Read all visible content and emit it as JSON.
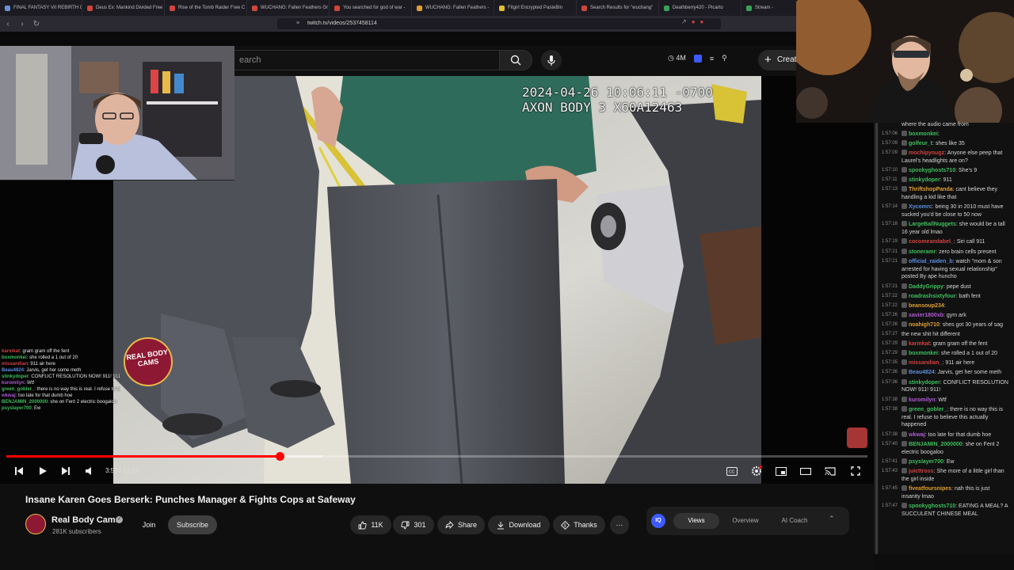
{
  "browser": {
    "tabs": [
      {
        "label": "FINAL FANTASY VII REBIRTH C",
        "color": "#6b8fd6"
      },
      {
        "label": "Deus Ex: Mankind Divided Free",
        "color": "#d0453a"
      },
      {
        "label": "Rise of the Tomb Raider Free C",
        "color": "#d0453a"
      },
      {
        "label": "WUCHANG: Fallen Feathers Gr",
        "color": "#d0453a"
      },
      {
        "label": "You searched for god of war -",
        "color": "#d0453a"
      },
      {
        "label": "WUCHANG: Fallen Feathers - ",
        "color": "#e0a030"
      },
      {
        "label": "Fitgirl Encrypted PasteBin",
        "color": "#e0c030"
      },
      {
        "label": "Search Results for \"wuchang\"",
        "color": "#d0453a"
      },
      {
        "label": "Deathberry420 - Picarto",
        "color": "#3aa05a"
      },
      {
        "label": "Stream -",
        "color": "#3aa05a"
      }
    ],
    "url": "twitch.tv/videos/2537458114"
  },
  "youtube": {
    "search_placeholder": "earch",
    "ext_count": "4M",
    "create_label": "Create",
    "colors": {
      "accent": "#ff0000",
      "bg": "#0f0f0f"
    }
  },
  "video": {
    "overlay_timestamp": "2024-04-26 10:06:11 -0700\nAXON BODY 3 X60A12463",
    "logo_text": "REAL BODY CAMS",
    "time_display": "3:53 / 12:16",
    "progress_fraction": 0.317,
    "buffer_fraction": 0.05,
    "controls": [
      "previous-icon",
      "play-icon",
      "next-icon",
      "volume-icon",
      "captions-icon",
      "settings-icon",
      "miniplayer-icon",
      "theater-icon",
      "cast-icon",
      "fullscreen-icon"
    ]
  },
  "overlay_chat": [
    {
      "user": "karmkat",
      "msg": "gram gram off the fent",
      "color": "#d14242"
    },
    {
      "user": "boxmonkei",
      "msg": "she rolled a 1 out of 20",
      "color": "#3fbf5f"
    },
    {
      "user": "missandian",
      "msg": "911 air here",
      "color": "#d14242"
    },
    {
      "user": "Beau4824",
      "msg": "Jarvis, get her some meth",
      "color": "#5b8fe0"
    },
    {
      "user": "stinkydoper",
      "msg": "CONFLICT RESOLUTION NOW! 911! 911!",
      "color": "#3fbf5f"
    },
    {
      "user": "kuromilyn",
      "msg": "Wtf",
      "color": "#b05ad6"
    },
    {
      "user": "green_gobler_",
      "msg": "there is no way this is real. I refuse to believe this actually happened",
      "color": "#3fbf5f"
    },
    {
      "user": "wkwaj",
      "msg": "too late for that dumb hoe",
      "color": "#b05ad6"
    },
    {
      "user": "BENJAMIN_2000000",
      "msg": "she on Fent 2 electric boogaloo",
      "color": "#3fbf5f"
    },
    {
      "user": "psyslayer700",
      "msg": "Ew",
      "color": "#3fbf5f"
    }
  ],
  "info": {
    "title": "Insane Karen Goes Berserk: Punches Manager & Fights Cops at Safeway",
    "channel": "Real Body Cams",
    "subscribers": "281K subscribers",
    "join": "Join",
    "subscribe": "Subscribe",
    "likes": "11K",
    "dislikes": "301",
    "share": "Share",
    "download": "Download",
    "thanks": "Thanks"
  },
  "iq": {
    "logo": "IQ",
    "tabs": [
      "Views",
      "Overview",
      "AI Coach"
    ]
  },
  "chat": [
    {
      "ts": "",
      "user": "",
      "msg": "where the audio came from",
      "color": "#d6d6d6"
    },
    {
      "ts": "1:57:06",
      "user": "boxmonkei",
      "msg": "",
      "color": "#3fbf5f"
    },
    {
      "ts": "1:57:09",
      "user": "golfeur_t",
      "msg": "shes like 35",
      "color": "#3fbf5f"
    },
    {
      "ts": "1:57:09",
      "user": "mochipynugz",
      "msg": "Anyone else peep that Laurel's headlights are on?",
      "color": "#d14242"
    },
    {
      "ts": "1:57:10",
      "user": "spookyghosts710",
      "msg": "She's 9",
      "color": "#3fbf5f"
    },
    {
      "ts": "1:57:11",
      "user": "stinkydoper",
      "msg": "911",
      "color": "#3fbf5f"
    },
    {
      "ts": "1:57:13",
      "user": "ThriftshopPanda",
      "msg": "cant believe they handling a kid like that",
      "color": "#e0a030"
    },
    {
      "ts": "1:57:14",
      "user": "Xycomrc",
      "msg": "being 30 in 2010 must have sucked you'd be close to 50 now",
      "color": "#5b8fe0"
    },
    {
      "ts": "1:57:18",
      "user": "LargeBallNuggets",
      "msg": "she would be a tall 16 year old lmao",
      "color": "#3fbf5f"
    },
    {
      "ts": "1:57:19",
      "user": "cocomeandabel_",
      "msg": "Siri call 911",
      "color": "#d14242"
    },
    {
      "ts": "1:57:21",
      "user": "stoneramr",
      "msg": "zero brain cells present",
      "color": "#3fbf5f"
    },
    {
      "ts": "1:57:21",
      "user": "official_raiden_b",
      "msg": "watch \"mom & son arrested for having sexual relationship\" posted By ape huncho",
      "color": "#5b8fe0"
    },
    {
      "ts": "1:57:21",
      "user": "DaddyGrippy",
      "msg": "pepe dust",
      "color": "#3fbf5f"
    },
    {
      "ts": "1:57:22",
      "user": "roadrashsixtyfour",
      "msg": "bath fent",
      "color": "#3fbf5f"
    },
    {
      "ts": "1:57:22",
      "user": "beansoup234",
      "msg": "",
      "color": "#e0a030"
    },
    {
      "ts": "1:57:26",
      "user": "xavier1800xb",
      "msg": "gym ark",
      "color": "#b05ad6"
    },
    {
      "ts": "1:57:26",
      "user": "noahigh710",
      "msg": "shes got 30 years of sag",
      "color": "#e0a030"
    },
    {
      "ts": "1:57:27",
      "user": "",
      "msg": "the new shit hit different",
      "color": "#3d5afe"
    },
    {
      "ts": "1:57:29",
      "user": "karmkat",
      "msg": "gram gram off the fent",
      "color": "#d14242"
    },
    {
      "ts": "1:57:29",
      "user": "boxmonkei",
      "msg": "she rolled a 1 out of 20",
      "color": "#3fbf5f"
    },
    {
      "ts": "1:57:35",
      "user": "missandian_",
      "msg": "911 air here",
      "color": "#d14242"
    },
    {
      "ts": "1:57:36",
      "user": "Beau4824",
      "msg": "Jarvis, get her some meth",
      "color": "#5b8fe0"
    },
    {
      "ts": "1:57:36",
      "user": "stinkydoper",
      "msg": "CONFLICT RESOLUTION NOW! 911! 911!",
      "color": "#3fbf5f"
    },
    {
      "ts": "1:57:38",
      "user": "kuromilyn",
      "msg": "Wtf",
      "color": "#b05ad6"
    },
    {
      "ts": "1:57:38",
      "user": "green_gobler_",
      "msg": "there is no way this is real. I refuse to believe this actually happened",
      "color": "#3fbf5f"
    },
    {
      "ts": "1:57:38",
      "user": "wkwaj",
      "msg": "too late for that dumb hoe",
      "color": "#b05ad6"
    },
    {
      "ts": "1:57:40",
      "user": "BENJAMIN_2000000",
      "msg": "she on Fent 2 electric boogaloo",
      "color": "#3fbf5f"
    },
    {
      "ts": "1:57:41",
      "user": "psyslayer700",
      "msg": "Ew",
      "color": "#3fbf5f"
    },
    {
      "ts": "1:57:43",
      "user": "juicttross",
      "msg": "She more of a little girl than the girl inside",
      "color": "#d14242"
    },
    {
      "ts": "1:57:45",
      "user": "fiveatfoursnipes",
      "msg": "nah this is just insanity lmao",
      "color": "#e0a030"
    },
    {
      "ts": "1:57:47",
      "user": "spookyghosts710",
      "msg": "EATING A MEAL? A SUCCULENT CHINESE MEAL",
      "color": "#3fbf5f"
    }
  ]
}
